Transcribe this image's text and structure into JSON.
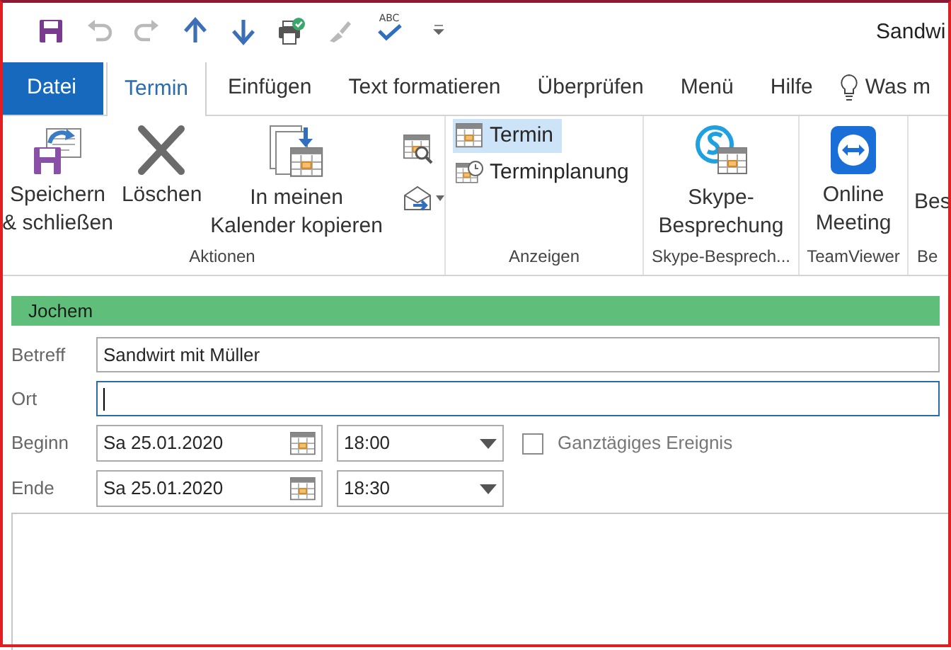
{
  "quick_access": [
    {
      "kind": "save",
      "disabled": false
    },
    {
      "kind": "undo",
      "disabled": true
    },
    {
      "kind": "redo",
      "disabled": true
    },
    {
      "kind": "up",
      "disabled": false
    },
    {
      "kind": "down",
      "disabled": false
    },
    {
      "kind": "print",
      "disabled": false
    },
    {
      "kind": "brush",
      "disabled": true
    },
    {
      "kind": "spell",
      "disabled": false,
      "label": "ABC"
    },
    {
      "kind": "more"
    }
  ],
  "window": {
    "title": "Sandwi"
  },
  "tabs": [
    {
      "label": "Datei",
      "kind": "file",
      "selected": false
    },
    {
      "label": "Termin",
      "kind": "tab",
      "selected": true
    },
    {
      "label": "Einfügen",
      "kind": "tab",
      "selected": false
    },
    {
      "label": "Text formatieren",
      "kind": "tab",
      "selected": false
    },
    {
      "label": "Überprüfen",
      "kind": "tab",
      "selected": false
    },
    {
      "label": "Menü",
      "kind": "tab",
      "selected": false
    },
    {
      "label": "Hilfe",
      "kind": "tab",
      "selected": false
    },
    {
      "label": "Was m",
      "kind": "tell"
    }
  ],
  "ribbon": [
    {
      "label": "Aktionen",
      "items": [
        {
          "kind": "save-close",
          "label": "Speichern\n& schließen"
        },
        {
          "kind": "delete",
          "label": "Löschen"
        },
        {
          "kind": "copy-cal",
          "label": "In meinen\nKalender kopieren"
        },
        {
          "kind": "small-icons"
        }
      ]
    },
    {
      "label": "Anzeigen",
      "items": [
        {
          "kind": "view",
          "label": "Termin",
          "selected": true
        },
        {
          "kind": "view",
          "label": "Terminplanung",
          "selected": false
        }
      ]
    },
    {
      "label": "Skype-Besprech...",
      "items": [
        {
          "kind": "skype",
          "label": "Skype-\nBesprechung"
        }
      ]
    },
    {
      "label": "TeamViewer",
      "items": [
        {
          "kind": "teamviewer",
          "label": "Online\nMeeting"
        }
      ]
    },
    {
      "label": "Be",
      "items": [
        {
          "kind": "cut",
          "label": "Bes"
        }
      ]
    }
  ],
  "organizer": "Jochem",
  "subject": {
    "label": "Betreff",
    "value": "Sandwirt mit Müller"
  },
  "location": {
    "label": "Ort",
    "focused": true
  },
  "start": {
    "label": "Beginn",
    "date": "Sa 25.01.2020",
    "time": "18:00"
  },
  "end": {
    "label": "Ende",
    "date": "Sa 25.01.2020",
    "time": "18:30"
  },
  "all_day": {
    "label": "Ganztägiges Ereignis",
    "checked": false
  }
}
